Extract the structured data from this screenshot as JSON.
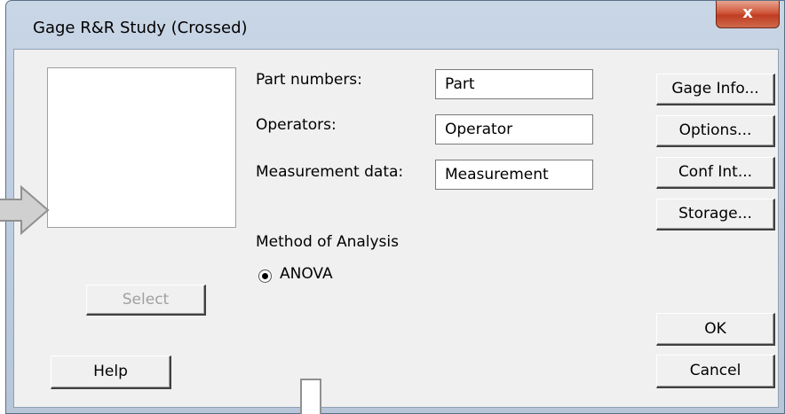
{
  "window": {
    "title": "Gage R&R Study (Crossed)",
    "close_label": "x"
  },
  "selection": {
    "select_label": "Select",
    "help_label": "Help"
  },
  "fields": {
    "part_label": "Part numbers:",
    "part_value": "Part",
    "operators_label": "Operators:",
    "operators_value": "Operator",
    "measurement_label": "Measurement data:",
    "measurement_value": "Measurement"
  },
  "method": {
    "heading": "Method of Analysis",
    "option_label": "ANOVA",
    "selected": true
  },
  "side_buttons": {
    "gage_info": "Gage Info...",
    "options": "Options...",
    "conf_int": "Conf Int...",
    "storage": "Storage..."
  },
  "actions": {
    "ok": "OK",
    "cancel": "Cancel"
  }
}
